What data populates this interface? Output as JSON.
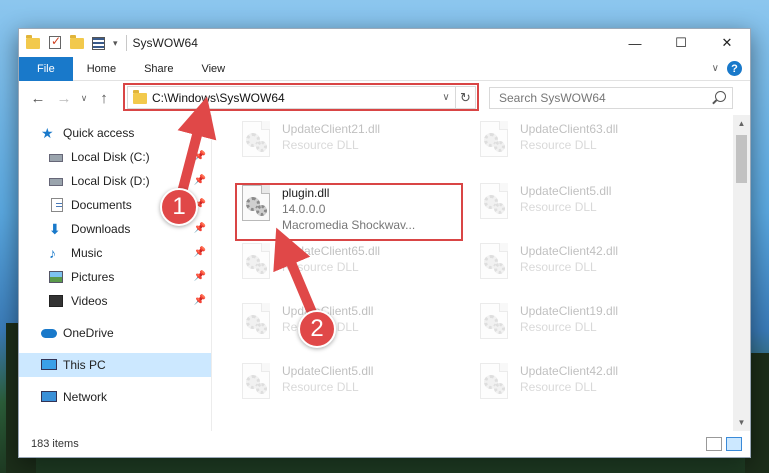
{
  "window": {
    "title": "SysWOW64",
    "controls": {
      "minimize": "—",
      "maximize": "☐",
      "close": "✕"
    }
  },
  "ribbon": {
    "tabs": [
      "File",
      "Home",
      "Share",
      "View"
    ],
    "expand": "∨",
    "help": "?"
  },
  "nav": {
    "back": "←",
    "forward": "→",
    "recent": "∨",
    "up": "↑",
    "address": "C:\\Windows\\SysWOW64",
    "address_dropdown": "∨",
    "refresh": "↻",
    "search_placeholder": "Search SysWOW64"
  },
  "sidebar": {
    "quick_access": "Quick access",
    "items": [
      {
        "label": "Local Disk (C:)",
        "icon": "disk-icon",
        "pinned": true
      },
      {
        "label": "Local Disk (D:)",
        "icon": "disk-icon",
        "pinned": true
      },
      {
        "label": "Documents",
        "icon": "documents-icon",
        "pinned": true
      },
      {
        "label": "Downloads",
        "icon": "downloads-icon",
        "pinned": true
      },
      {
        "label": "Music",
        "icon": "music-icon",
        "pinned": true
      },
      {
        "label": "Pictures",
        "icon": "pictures-icon",
        "pinned": true
      },
      {
        "label": "Videos",
        "icon": "videos-icon",
        "pinned": true
      }
    ],
    "onedrive": "OneDrive",
    "this_pc": "This PC",
    "network": "Network"
  },
  "files": [
    {
      "name": "UpdateClient21.dll",
      "sub": "Resource DLL"
    },
    {
      "name": "UpdateClient63.dll",
      "sub": "Resource DLL"
    },
    {
      "name": "plugin.dll",
      "version": "14.0.0.0",
      "sub": "Macromedia Shockwav..."
    },
    {
      "name": "UpdateClient5.dll",
      "sub": "Resource DLL"
    },
    {
      "name": "UpdateClient65.dll",
      "sub": "Resource DLL"
    },
    {
      "name": "UpdateClient42.dll",
      "sub": "Resource DLL"
    },
    {
      "name": "UpdateClient5.dll",
      "sub": "Resource DLL"
    },
    {
      "name": "UpdateClient19.dll",
      "sub": "Resource DLL"
    },
    {
      "name": "UpdateClient5.dll",
      "sub": "Resource DLL"
    },
    {
      "name": "UpdateClient42.dll",
      "sub": "Resource DLL"
    }
  ],
  "status": {
    "count": "183 items"
  },
  "annotations": {
    "step1": "1",
    "step2": "2"
  },
  "colors": {
    "accent": "#1979ca",
    "highlight": "#d94545",
    "selected": "#cce8ff"
  }
}
